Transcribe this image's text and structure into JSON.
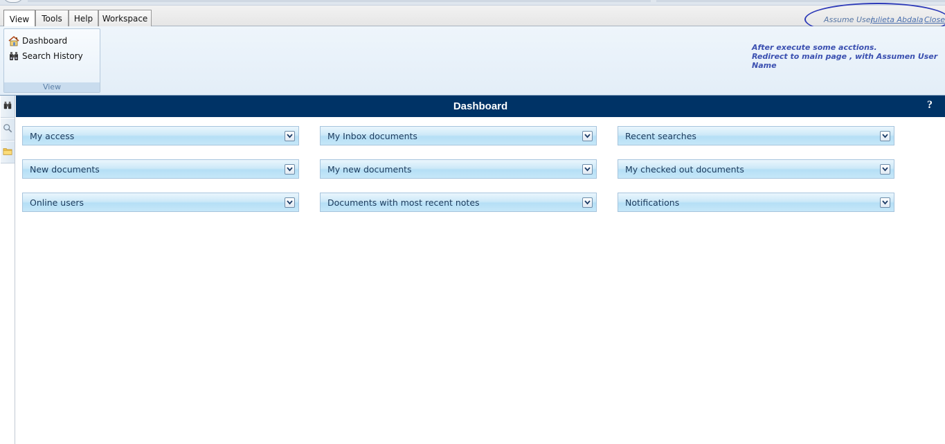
{
  "tabs": [
    {
      "label": "View",
      "active": true
    },
    {
      "label": "Tools",
      "active": false
    },
    {
      "label": "Help",
      "active": false
    },
    {
      "label": "Workspace",
      "active": false
    }
  ],
  "assume": {
    "label": "Assume User",
    "user": "julieta Abdala",
    "close": "Close"
  },
  "ribbon": {
    "items": [
      {
        "label": "Dashboard",
        "icon": "home-icon"
      },
      {
        "label": "Search History",
        "icon": "binoculars-icon"
      }
    ],
    "group_label": "View"
  },
  "note": {
    "lines": [
      "After execute some acctions.",
      "Redirect to main page , with Assumen User",
      "Name"
    ]
  },
  "leftbar": {
    "icons": [
      "binoculars-icon",
      "search-icon",
      "folder-icon"
    ]
  },
  "header": {
    "title": "Dashboard",
    "help": "?"
  },
  "panels": [
    {
      "title": "My access"
    },
    {
      "title": "My Inbox documents"
    },
    {
      "title": "Recent searches"
    },
    {
      "title": "New documents"
    },
    {
      "title": "My new documents"
    },
    {
      "title": "My checked out documents"
    },
    {
      "title": "Online users"
    },
    {
      "title": "Documents with most recent notes"
    },
    {
      "title": "Notifications"
    }
  ],
  "colors": {
    "header_bg": "#003366",
    "annotation": "#2d3ab8",
    "note_text": "#3a4fb0"
  }
}
